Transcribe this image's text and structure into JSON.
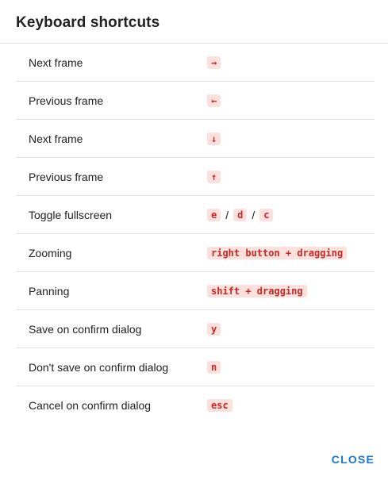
{
  "dialog": {
    "title": "Keyboard shortcuts",
    "close_label": "CLOSE"
  },
  "shortcuts": [
    {
      "action": "Next frame",
      "keys": [
        "→"
      ]
    },
    {
      "action": "Previous frame",
      "keys": [
        "←"
      ]
    },
    {
      "action": "Next frame",
      "keys": [
        "↓"
      ]
    },
    {
      "action": "Previous frame",
      "keys": [
        "↑"
      ]
    },
    {
      "action": "Toggle fullscreen",
      "keys": [
        "e",
        "d",
        "c"
      ],
      "separator": "/"
    },
    {
      "action": "Zooming",
      "keys": [
        "right button + dragging"
      ]
    },
    {
      "action": "Panning",
      "keys": [
        "shift + dragging"
      ]
    },
    {
      "action": "Save on confirm dialog",
      "keys": [
        "y"
      ]
    },
    {
      "action": "Don't save on confirm dialog",
      "keys": [
        "n"
      ]
    },
    {
      "action": "Cancel on confirm dialog",
      "keys": [
        "esc"
      ]
    }
  ],
  "colors": {
    "key_text": "#c62828",
    "key_background": "#fde0dc",
    "accent": "#1976d2"
  }
}
